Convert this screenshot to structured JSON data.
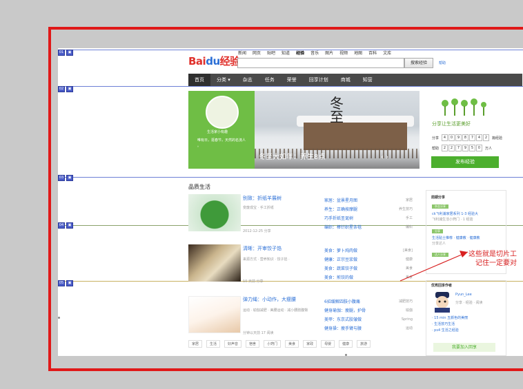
{
  "header": {
    "logo_bai": "Bai",
    "logo_du": "du",
    "logo_suffix": "经验",
    "topnav": [
      "新闻",
      "网页",
      "贴吧",
      "知道",
      "经验",
      "音乐",
      "图片",
      "视频",
      "地图",
      "百科",
      "文库"
    ],
    "topnav_active_index": 4,
    "search_value": "",
    "search_button": "搜索经验",
    "help": "帮助"
  },
  "mainnav": {
    "items": [
      "首页",
      "分类 ▾",
      "杂志",
      "任务",
      "荣誉",
      "回享计划",
      "商城",
      "知营"
    ],
    "active_index": 0
  },
  "banner": {
    "user_name": "生活家小有趣",
    "quote": "唯有日，逛春节，天然的名流人 。",
    "title": "冬至大如年：养生8点",
    "calligraphy": "冬至",
    "arrows": "‹    ›"
  },
  "right_panel": {
    "slogan": "分享让生活更美好",
    "row1_label": "分享",
    "row1_cells": [
      "4",
      "0",
      "9",
      "8",
      "7",
      "4",
      "2"
    ],
    "row1_suffix": "篇经验",
    "row2_label": "帮助",
    "row2_cells": [
      "2",
      "2",
      "7",
      "9",
      "5",
      "0"
    ],
    "row2_suffix": "万人",
    "publish_button": "发布经验"
  },
  "section": {
    "title": "品质生活",
    "articles": [
      {
        "title": "别致：折纸羊展树",
        "meta": "变废成宝 · 手工折纸",
        "meta2": "2012-12-25  分享"
      },
      {
        "title": "清晰：开审饺子馅",
        "meta": "来源方式 · 营养知识 · 饺子馅 ·",
        "meta2": "10 天前  分享"
      },
      {
        "title": "弹力绳：小动作，大瘦腰",
        "meta": "运动 · 瑜伽减肥 · 美腰运动 · 减小腰肢腹臀",
        "meta2": "分钟以天前   17 阅读"
      }
    ],
    "lists": [
      [
        {
          "t": "家居：盆景星月图",
          "r": "家居"
        },
        {
          "t": "养生：正确按摩腿",
          "r": "养生技巧"
        },
        {
          "t": "巧手折纸圣诞树",
          "r": "手工"
        },
        {
          "t": "编织：棒针织星条毯",
          "r": "编织"
        }
      ],
      [
        {
          "t": "美食：萝卜炖肉做",
          "r": "[美食]"
        },
        {
          "t": "健康：正宗豆浆做",
          "r": "健康"
        },
        {
          "t": "美食：蔬菜饺子做",
          "r": "美食"
        },
        {
          "t": "美食：煎饺的做",
          "r": "美食"
        }
      ],
      [
        {
          "t": "6招缓解四肢小腹痛",
          "r": "减肥技巧"
        },
        {
          "t": "健身瑜伽：瘦腿，护骨",
          "r": "瑜伽"
        },
        {
          "t": "美甲：东京式胶皱做",
          "r": "Spring"
        },
        {
          "t": "健身操：瘦手臂与腰",
          "r": "运动"
        }
      ]
    ],
    "tags": [
      "家居",
      "生活",
      "好声音",
      "宿舍",
      "小窍门",
      "美食",
      "家政",
      "母婴",
      "健康",
      "旅游"
    ]
  },
  "side": {
    "title": "前期分享",
    "tag1": "杂志分享",
    "item1": "ck飞利浦家居系列 1-3 经验大",
    "item1_meta": "飞利浦生活小窍门 · 1 经验",
    "tag2": "分享",
    "item2": "生活贴士推荐 · 健康教 · 健康教",
    "item2_meta": "分享达人",
    "tag3": "达人分享",
    "team_title": "优秀回享作者",
    "user": "Pyun_Lee",
    "user_meta": "分享 · 经验 · 阅读",
    "team_items": [
      "15 min 五颜色的美丽",
      "生活技巧生活",
      "ps4 生活之经验"
    ],
    "join_button": "我要加入回享"
  },
  "annotation": {
    "line1": "这些就是切片工",
    "line2": "记住一定要对"
  },
  "colors": {
    "frame": "#e01818",
    "slice_line": "#6b7fd6",
    "brand_green": "#4caf2e",
    "link": "#2b6fd6"
  }
}
